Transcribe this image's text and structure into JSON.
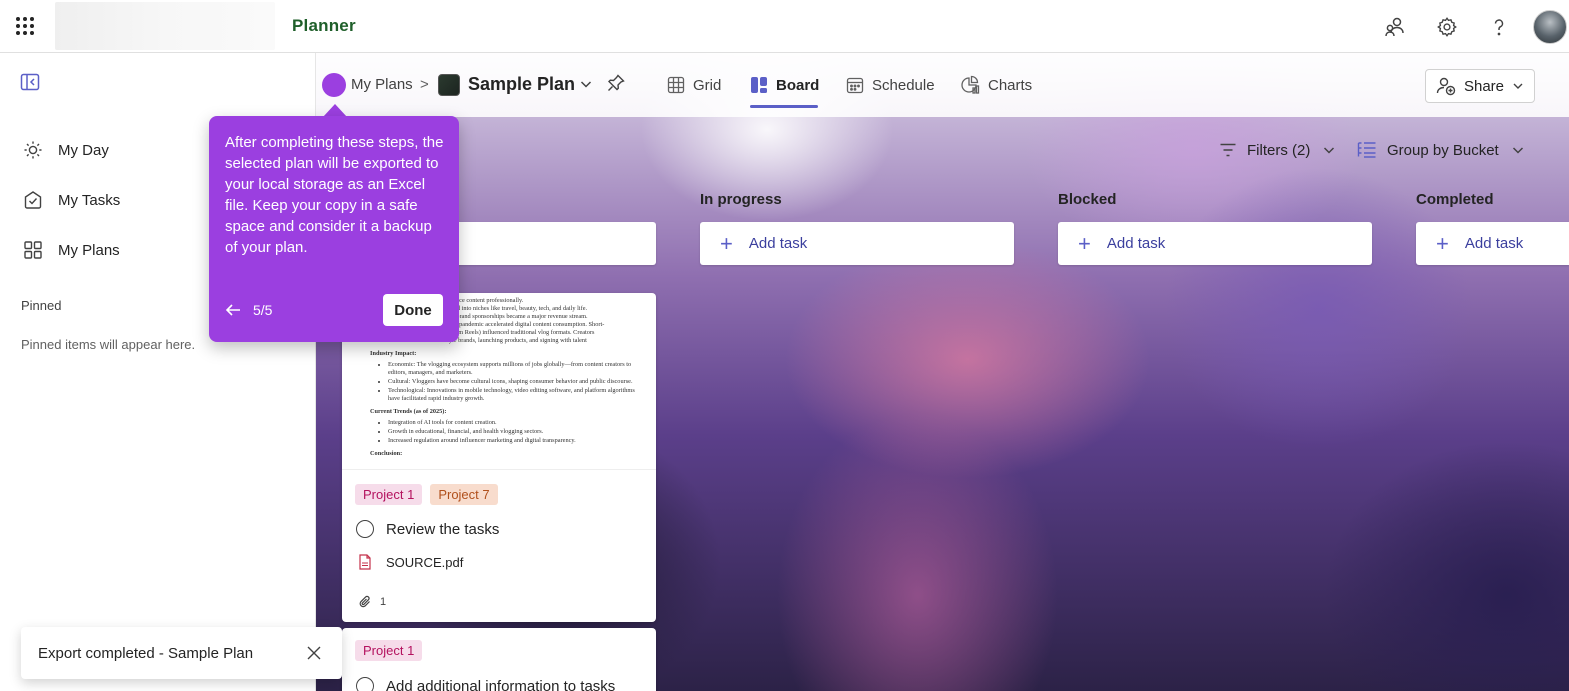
{
  "app": {
    "title": "Planner"
  },
  "leftnav": {
    "items": [
      {
        "label": "My Day",
        "icon": "sun-icon"
      },
      {
        "label": "My Tasks",
        "icon": "tasks-icon"
      },
      {
        "label": "My Plans",
        "icon": "plans-icon"
      }
    ],
    "pinned_title": "Pinned",
    "pinned_empty": "Pinned items will appear here."
  },
  "breadcrumb": {
    "root": "My Plans",
    "separator": ">",
    "plan_name": "Sample Plan"
  },
  "views": [
    {
      "label": "Grid",
      "icon": "grid-icon",
      "active": false
    },
    {
      "label": "Board",
      "icon": "board-icon",
      "active": true
    },
    {
      "label": "Schedule",
      "icon": "calendar-icon",
      "active": false
    },
    {
      "label": "Charts",
      "icon": "charts-icon",
      "active": false
    }
  ],
  "share": {
    "label": "Share"
  },
  "toolbar": {
    "filters_label": "Filters (2)",
    "group_label": "Group by Bucket"
  },
  "buckets": [
    {
      "name": "In progress",
      "add_label": "Add task"
    },
    {
      "name": "Blocked",
      "add_label": "Add task"
    },
    {
      "name": "Completed",
      "add_label": "Add task"
    }
  ],
  "cards": [
    {
      "preview": {
        "lines": [
          "to produce content professionally.",
          "versified into niches like travel, beauty, tech, and daily life.",
          "ly, and brand sponsorships became a major revenue stream.",
          "VID-19 pandemic accelerated digital content consumption. Short-",
          "Instagram Reels) influenced traditional vlog formats. Creators",
          "ifestyle brands, launching products, and signing with talent"
        ],
        "section1_title": "Industry Impact:",
        "section1_items": [
          "Economic: The vlogging ecosystem supports millions of jobs globally—from content creators to editors, managers, and marketers.",
          "Cultural: Vloggers have become cultural icons, shaping consumer behavior and public discourse.",
          "Technological: Innovations in mobile technology, video editing software, and platform algorithms have facilitated rapid industry growth."
        ],
        "section2_title": "Current Trends (as of 2025):",
        "section2_items": [
          "Integration of AI tools for content creation.",
          "Growth in educational, financial, and health vlogging sectors.",
          "Increased regulation around influencer marketing and digital transparency."
        ],
        "section3_title": "Conclusion:"
      },
      "tags": [
        "Project 1",
        "Project 7"
      ],
      "title": "Review the tasks",
      "attachment": "SOURCE.pdf",
      "attachment_count": "1"
    },
    {
      "tags": [
        "Project 1"
      ],
      "title": "Add additional information to tasks"
    }
  ],
  "teaching_bubble": {
    "text": "After completing these steps, the selected plan will be exported to your local storage as an Excel file. Keep your copy in a safe space and consider it a backup of your plan.",
    "step": "5/5",
    "done_label": "Done"
  },
  "toast": {
    "message": "Export completed - Sample Plan"
  },
  "colors": {
    "accent": "#9b3fe0",
    "brand_green": "#1f5f2a",
    "tab_underline": "#5b5fc7",
    "link": "#3b3f9e"
  }
}
